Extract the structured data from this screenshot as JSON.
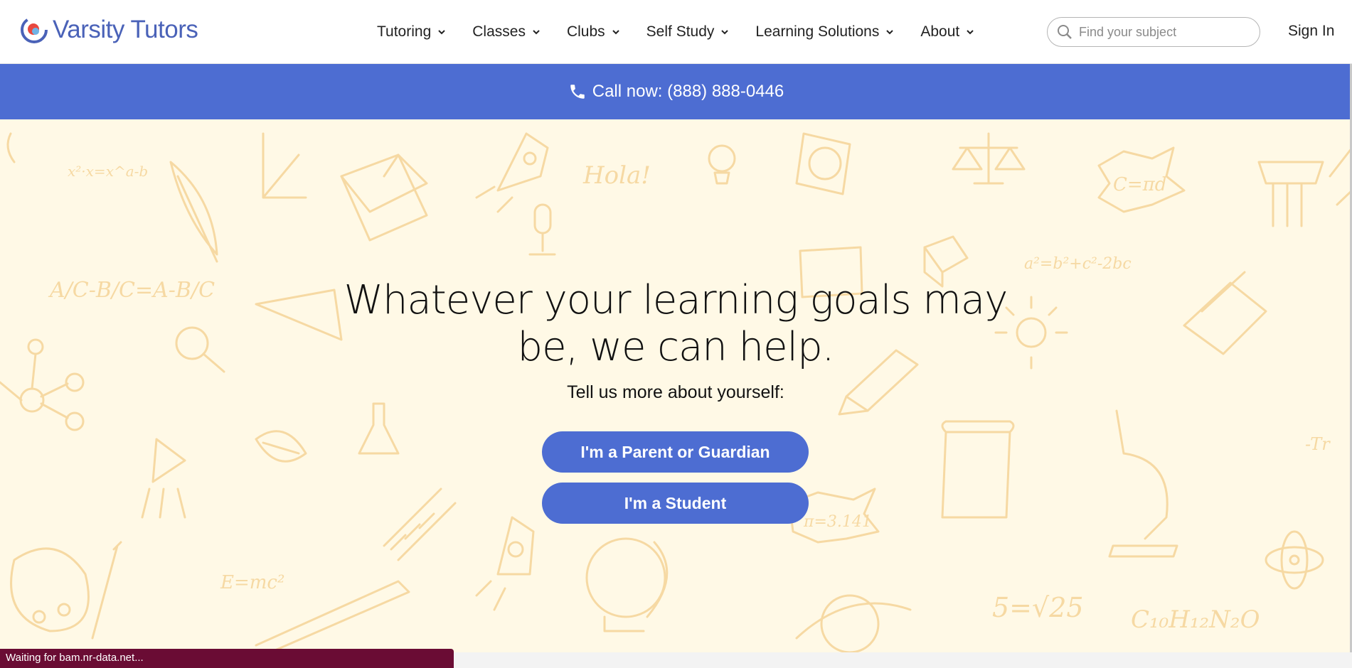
{
  "header": {
    "brand": "Varsity Tutors",
    "nav": [
      {
        "label": "Tutoring"
      },
      {
        "label": "Classes"
      },
      {
        "label": "Clubs"
      },
      {
        "label": "Self Study"
      },
      {
        "label": "Learning Solutions"
      },
      {
        "label": "About"
      }
    ],
    "search_placeholder": "Find your subject",
    "sign_in": "Sign In"
  },
  "callbar": {
    "text": "Call now: (888) 888-0446",
    "icon": "phone-icon"
  },
  "hero": {
    "headline": "Whatever your learning goals may be, we can help.",
    "subline": "Tell us more about yourself:",
    "btn_parent": "I'm a Parent or Guardian",
    "btn_student": "I'm a Student"
  },
  "status_bar": {
    "text": "Waiting for bam.nr-data.net..."
  },
  "colors": {
    "brand_blue": "#4d6dd2",
    "hero_bg": "#fff9e6",
    "doodle": "#f6d9a3",
    "status_bg": "#6a0c34"
  }
}
